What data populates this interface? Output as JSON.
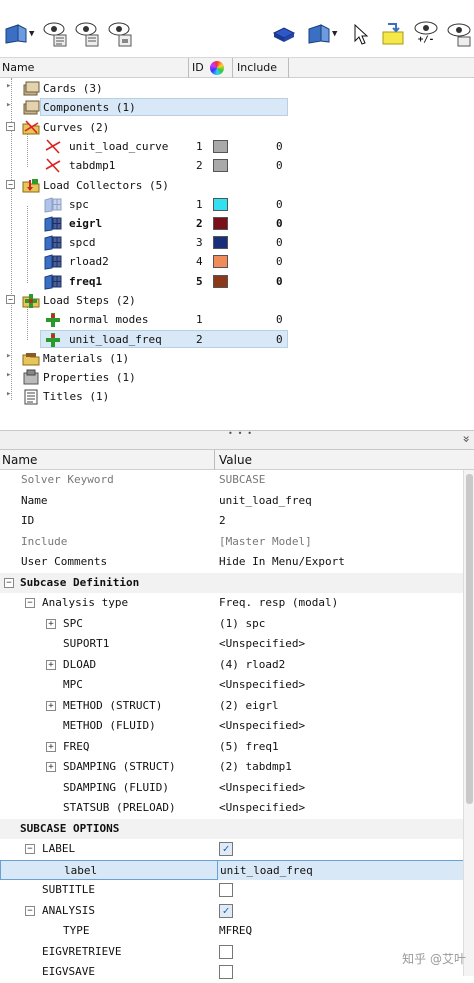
{
  "toolbar": {
    "icons": [
      "component-view-icon",
      "eye-show-icon",
      "eye-hide-icon",
      "eye-isolate-icon",
      "box-select-icon",
      "component-view-icon",
      "cursor-icon",
      "highlight-icon",
      "eye-plusminus-icon",
      "eye-icon"
    ],
    "eye_pm_label": "+/-"
  },
  "tree": {
    "columns": {
      "name": "Name",
      "id": "ID",
      "include": "Include"
    },
    "rows": [
      {
        "label": "Cards (3)"
      },
      {
        "label": "Components (1)"
      },
      {
        "label": "Curves (2)"
      },
      {
        "label": "unit_load_curve",
        "id": "1",
        "include": "0",
        "color": "#a9a9a9"
      },
      {
        "label": "tabdmp1",
        "id": "2",
        "include": "0",
        "color": "#a9a9a9"
      },
      {
        "label": "Load Collectors (5)"
      },
      {
        "label": "spc",
        "id": "1",
        "include": "0",
        "color": "#33e0ef"
      },
      {
        "label": "eigrl",
        "id": "2",
        "include": "0",
        "color": "#7a0f1a"
      },
      {
        "label": "spcd",
        "id": "3",
        "include": "0",
        "color": "#1a2f7a"
      },
      {
        "label": "rload2",
        "id": "4",
        "include": "0",
        "color": "#f08c5a"
      },
      {
        "label": "freq1",
        "id": "5",
        "include": "0",
        "color": "#8a3a1a"
      },
      {
        "label": "Load Steps (2)"
      },
      {
        "label": "normal  modes",
        "id": "1",
        "include": "0"
      },
      {
        "label": "unit_load_freq",
        "id": "2",
        "include": "0"
      },
      {
        "label": "Materials (1)"
      },
      {
        "label": "Properties (1)"
      },
      {
        "label": "Titles (1)"
      }
    ]
  },
  "splitter": {
    "grip": "• • •",
    "collapse": "»"
  },
  "props": {
    "columns": {
      "name": "Name",
      "value": "Value"
    },
    "rows": [
      {
        "name": "Solver Keyword",
        "value": "SUBCASE"
      },
      {
        "name": "Name",
        "value": "unit_load_freq"
      },
      {
        "name": "ID",
        "value": "2"
      },
      {
        "name": "Include",
        "value": "[Master Model]"
      },
      {
        "name": "User Comments",
        "value": "Hide In Menu/Export"
      },
      {
        "name": "Subcase Definition",
        "value": ""
      },
      {
        "name": "Analysis type",
        "value": "Freq. resp (modal)"
      },
      {
        "name": "SPC",
        "value": "(1) spc"
      },
      {
        "name": "SUPORT1",
        "value": "<Unspecified>"
      },
      {
        "name": "DLOAD",
        "value": "(4) rload2"
      },
      {
        "name": "MPC",
        "value": "<Unspecified>"
      },
      {
        "name": "METHOD (STRUCT)",
        "value": "(2) eigrl"
      },
      {
        "name": "METHOD (FLUID)",
        "value": "<Unspecified>"
      },
      {
        "name": "FREQ",
        "value": "(5) freq1"
      },
      {
        "name": "SDAMPING (STRUCT)",
        "value": "(2) tabdmp1"
      },
      {
        "name": "SDAMPING (FLUID)",
        "value": "<Unspecified>"
      },
      {
        "name": "STATSUB (PRELOAD)",
        "value": "<Unspecified>"
      },
      {
        "name": "SUBCASE OPTIONS",
        "value": ""
      },
      {
        "name": "LABEL",
        "value": "",
        "checked": true
      },
      {
        "name": "label",
        "value": "unit_load_freq"
      },
      {
        "name": "SUBTITLE",
        "value": "",
        "checked": false
      },
      {
        "name": "ANALYSIS",
        "value": "",
        "checked": true
      },
      {
        "name": "TYPE",
        "value": "MFREQ"
      },
      {
        "name": "EIGVRETRIEVE",
        "value": "",
        "checked": false
      },
      {
        "name": "EIGVSAVE",
        "value": "",
        "checked": false
      }
    ]
  },
  "watermark": "知乎 @艾叶"
}
